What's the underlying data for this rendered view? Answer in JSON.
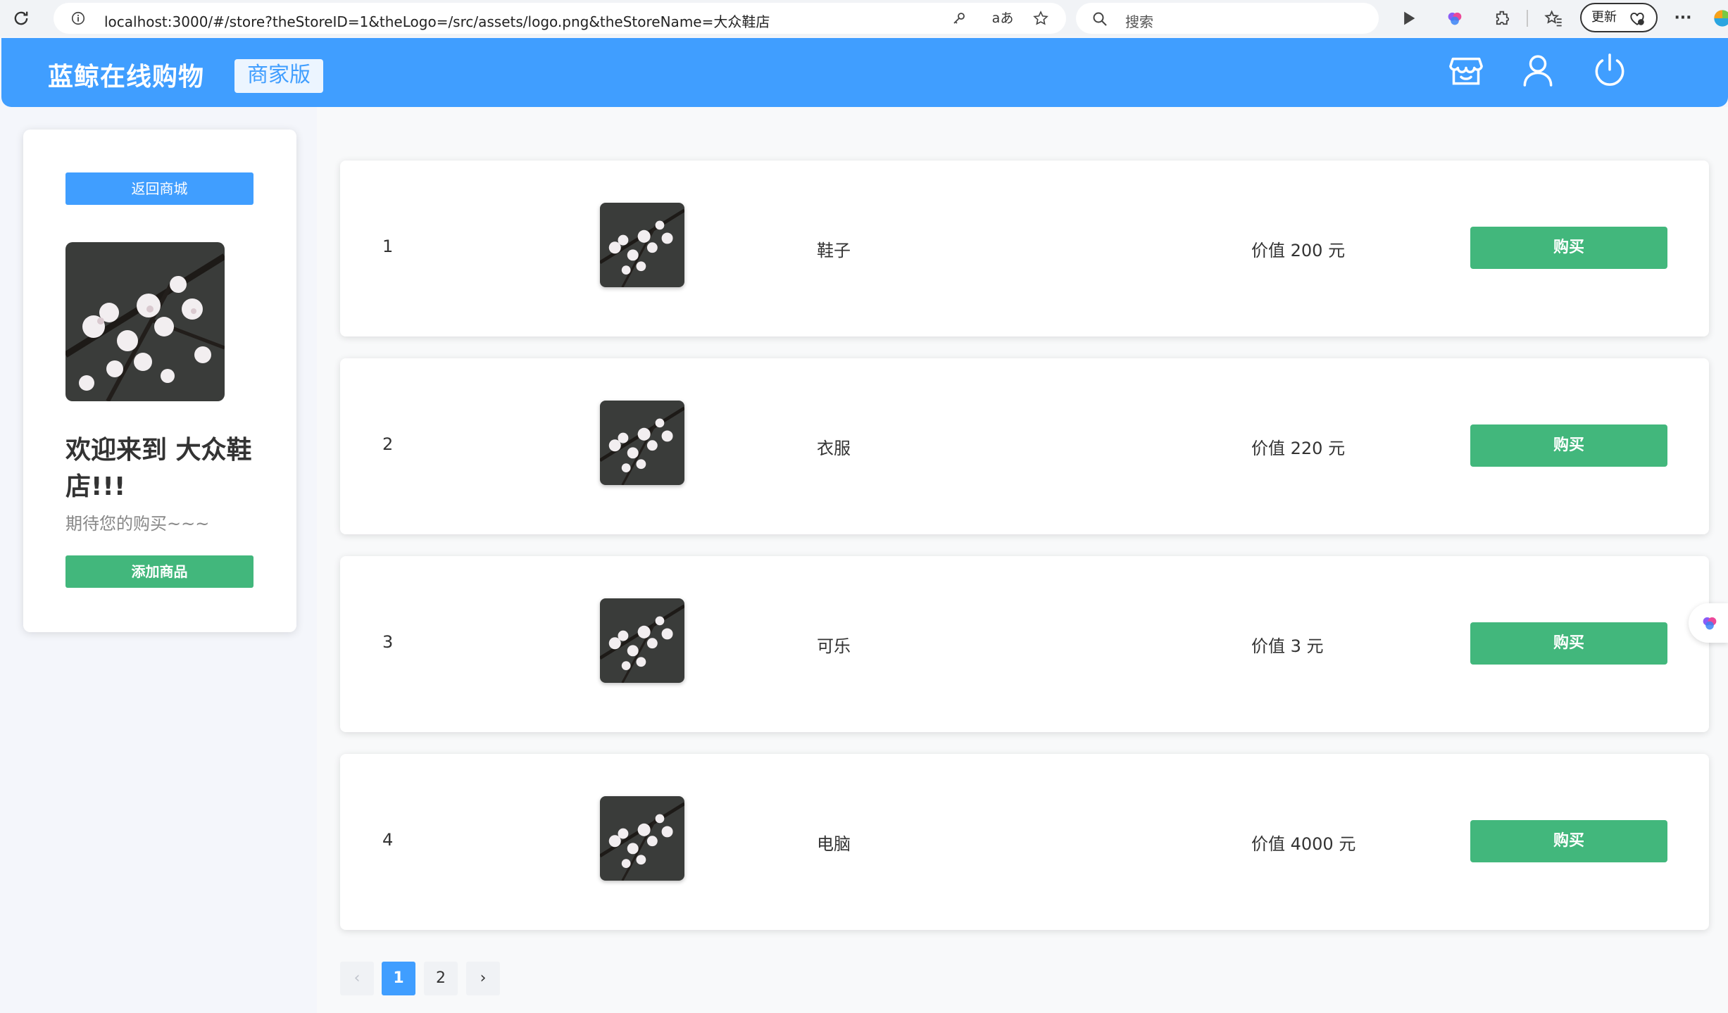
{
  "browser": {
    "url": "localhost:3000/#/store?theStoreID=1&theLogo=/src/assets/logo.png&theStoreName=大众鞋店",
    "search_placeholder": "搜索",
    "update_label": "更新"
  },
  "header": {
    "brand": "蓝鲸在线购物",
    "edition": "商家版"
  },
  "sidebar": {
    "back_button": "返回商城",
    "welcome": "欢迎来到 大众鞋店!!!",
    "subtitle": "期待您的购买~~~",
    "add_button": "添加商品"
  },
  "products": [
    {
      "index": "1",
      "name": "鞋子",
      "price": "价值 200 元",
      "buy": "购买"
    },
    {
      "index": "2",
      "name": "衣服",
      "price": "价值 220 元",
      "buy": "购买"
    },
    {
      "index": "3",
      "name": "可乐",
      "price": "价值 3 元",
      "buy": "购买"
    },
    {
      "index": "4",
      "name": "电脑",
      "price": "价值 4000 元",
      "buy": "购买"
    }
  ],
  "pagination": {
    "prev": "‹",
    "pages": [
      "1",
      "2"
    ],
    "current": "1",
    "next": "›"
  },
  "colors": {
    "primary": "#409eff",
    "success": "#42b77c"
  }
}
